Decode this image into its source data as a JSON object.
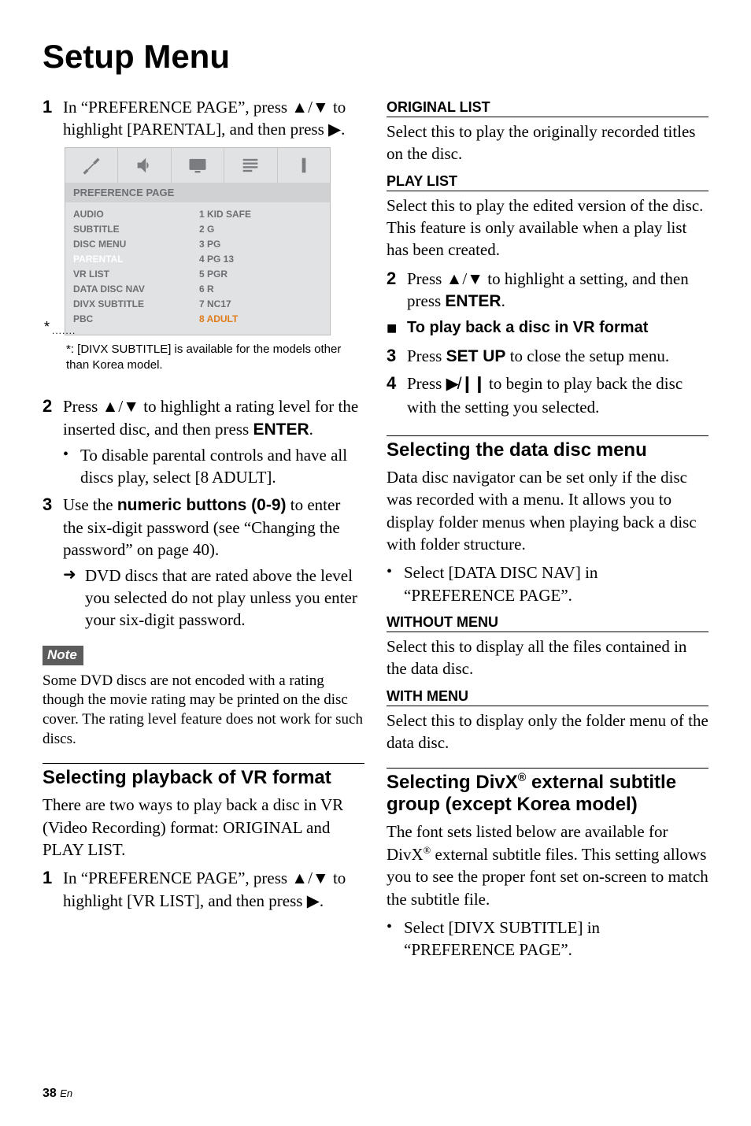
{
  "page_title": "Setup Menu",
  "left": {
    "step1": "In “PREFERENCE PAGE”, press ▲/▼ to highlight [PARENTAL], and then press ▶.",
    "osd": {
      "title": "PREFERENCE PAGE",
      "rows": [
        {
          "l": "AUDIO",
          "r": "1 KID SAFE"
        },
        {
          "l": "SUBTITLE",
          "r": "2 G"
        },
        {
          "l": "DISC MENU",
          "r": "3 PG"
        },
        {
          "l": "PARENTAL",
          "r": "4 PG 13"
        },
        {
          "l": "VR LIST",
          "r": "5 PGR"
        },
        {
          "l": "DATA DISC NAV",
          "r": "6 R"
        },
        {
          "l": "DIVX SUBTITLE",
          "r": "7 NC17"
        },
        {
          "l": "PBC",
          "r": "8 ADULT"
        }
      ],
      "star": "*",
      "note": ": [DIVX SUBTITLE] is available for the models other than Korea model."
    },
    "step2": "Press ▲/▼ to highlight a rating level for the inserted disc, and then press ",
    "step2_enter": "ENTER",
    "step2_dot": ".",
    "step2_b1": "To disable parental controls and have all discs play, select [8 ADULT].",
    "step3_a": "Use the ",
    "step3_btn": "numeric buttons (0-9)",
    "step3_b": " to enter the six-digit password (see “Changing the password” on page 40).",
    "step3_arrow": "DVD discs that are rated above the level you selected do not play unless you enter your six-digit password.",
    "note_label": "Note",
    "note_body": "Some DVD discs are not encoded with a rating though the movie rating may be printed on the disc cover. The rating level feature does not work for such discs.",
    "sec_vr": "Selecting playback of VR format",
    "vr_intro": "There are two ways to play back a disc in VR (Video Recording) format: ORIGINAL and PLAY LIST.",
    "vr_step1": "In “PREFERENCE PAGE”, press ▲/▼ to highlight [VR LIST], and then press ▶."
  },
  "right": {
    "orig_head": "ORIGINAL LIST",
    "orig_body": "Select this to play the originally recorded titles on the disc.",
    "play_head": "PLAY LIST",
    "play_body": "Select this to play the edited version of the disc. This feature is only available when a play list has been created.",
    "step2": "Press ▲/▼ to highlight a setting, and then press ",
    "step2_enter": "ENTER",
    "step2_dot": ".",
    "square_line": "To play back a disc in VR format",
    "step3_a": "Press ",
    "step3_btn": "SET UP",
    "step3_b": " to close the setup menu.",
    "step4_a": "Press ",
    "step4_glyph": "▶/❚❚",
    "step4_b": " to begin to play back the disc with the setting you selected.",
    "sec_data": "Selecting the data disc menu",
    "data_intro": "Data disc navigator can be set only if the disc was recorded with a menu. It allows you to display folder menus when playing back a disc with folder structure.",
    "data_bullet": "Select [DATA DISC NAV] in “PREFERENCE PAGE”.",
    "wo_head": "WITHOUT MENU",
    "wo_body": "Select this to display all the files contained in the data disc.",
    "w_head": "WITH MENU",
    "w_body": "Select this to display only the folder menu of the data disc.",
    "sec_divx_a": "Selecting DivX",
    "sec_divx_b": " external subtitle group (except Korea model)",
    "divx_intro_a": "The font sets listed below are available for DivX",
    "divx_intro_b": " external subtitle files. This setting allows you to see the proper font set on-screen to match the subtitle file.",
    "divx_bullet": "Select [DIVX SUBTITLE] in “PREFERENCE PAGE”."
  },
  "footer": {
    "page": "38",
    "lang": "En"
  }
}
